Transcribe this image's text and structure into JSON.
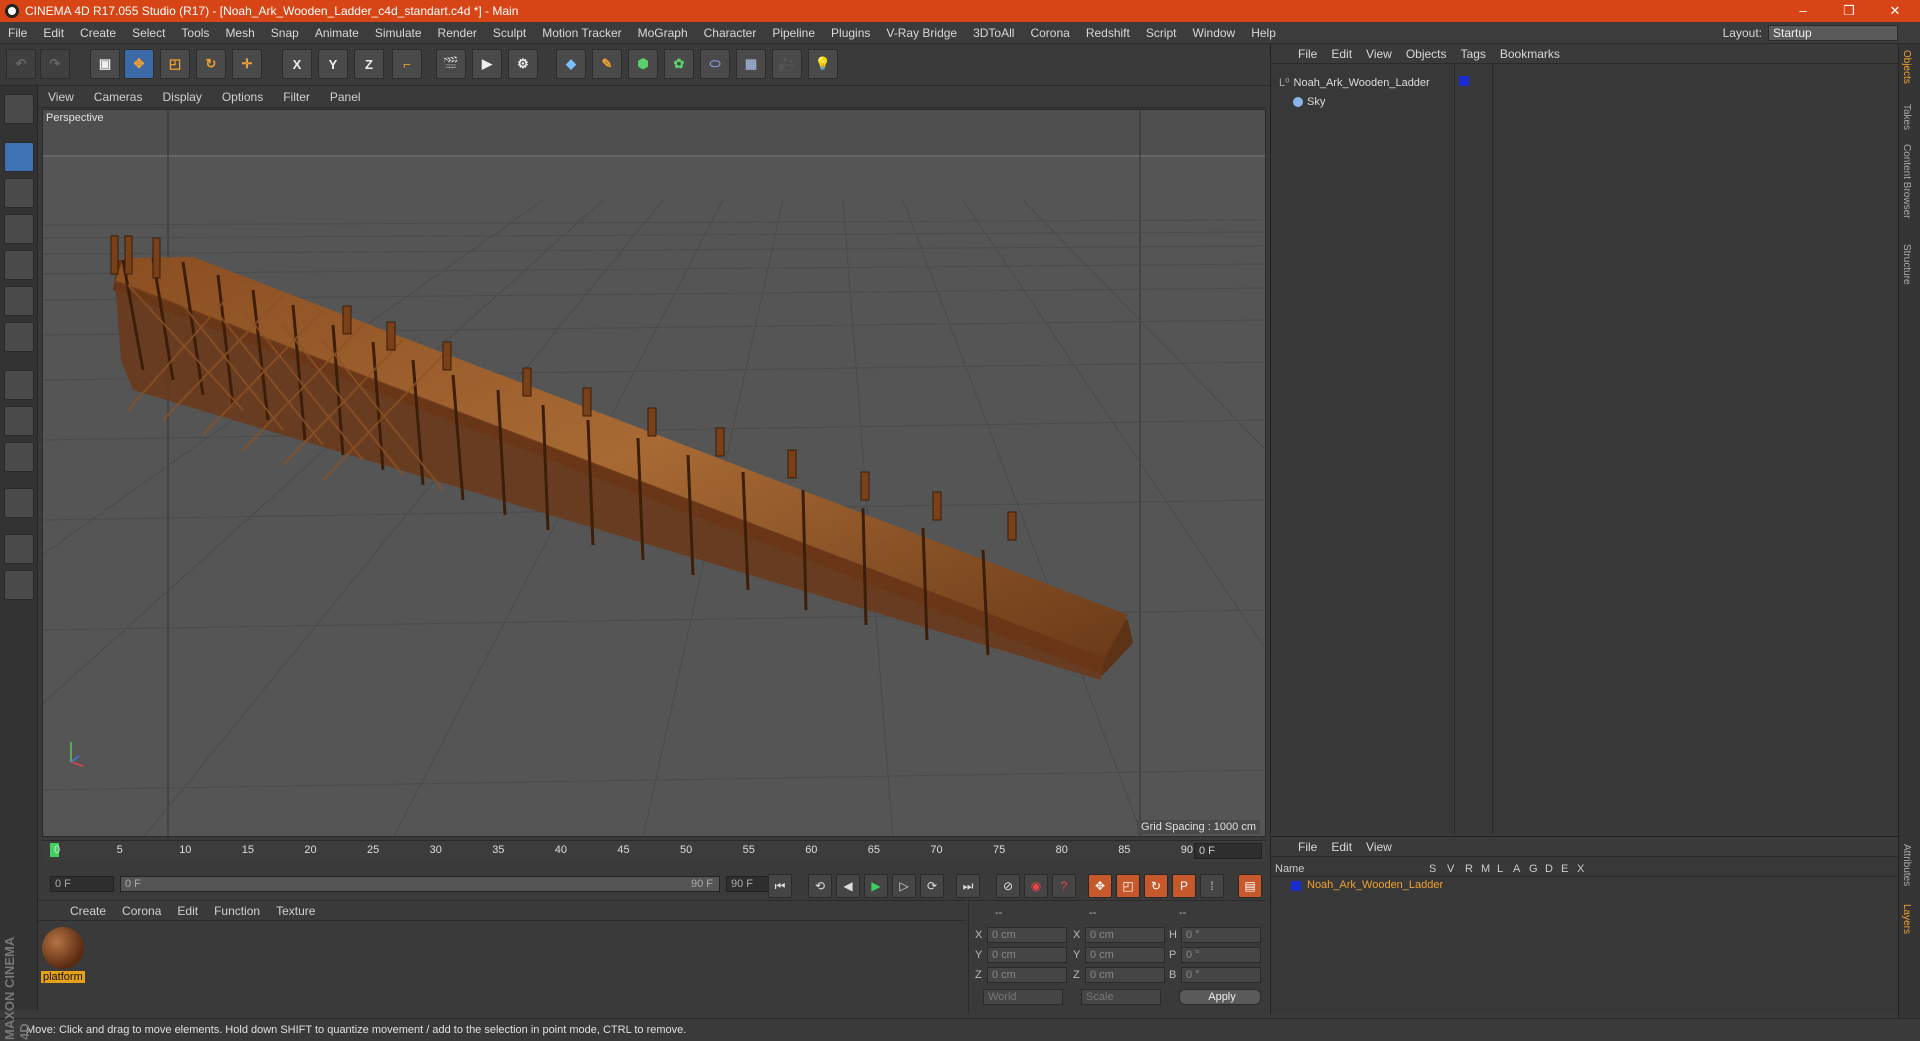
{
  "window": {
    "title": "CINEMA 4D R17.055 Studio (R17) - [Noah_Ark_Wooden_Ladder_c4d_standart.c4d *] - Main",
    "minimize": "–",
    "restore": "❐",
    "close": "✕"
  },
  "menubar": [
    "File",
    "Edit",
    "Create",
    "Select",
    "Tools",
    "Mesh",
    "Snap",
    "Animate",
    "Simulate",
    "Render",
    "Sculpt",
    "Motion Tracker",
    "MoGraph",
    "Character",
    "Pipeline",
    "Plugins",
    "V-Ray Bridge",
    "3DToAll",
    "Corona",
    "Redshift",
    "Script",
    "Window",
    "Help"
  ],
  "layout": {
    "label": "Layout:",
    "value": "Startup"
  },
  "toolbar": {
    "x": "X",
    "y": "Y",
    "z": "Z"
  },
  "viewport": {
    "menu": [
      "View",
      "Cameras",
      "Display",
      "Options",
      "Filter",
      "Panel"
    ],
    "label": "Perspective",
    "grid_spacing": "Grid Spacing : 1000 cm"
  },
  "timeline": {
    "ticks": [
      "0",
      "5",
      "10",
      "15",
      "20",
      "25",
      "30",
      "35",
      "40",
      "45",
      "50",
      "55",
      "60",
      "65",
      "70",
      "75",
      "80",
      "85",
      "90"
    ],
    "current_frame": "0 F"
  },
  "transport": {
    "start": "0 F",
    "range_start": "0 F",
    "range_end": "90 F",
    "end": "90 F"
  },
  "materials": {
    "menu": [
      "Create",
      "Corona",
      "Edit",
      "Function",
      "Texture"
    ],
    "items": [
      {
        "name": "platform"
      }
    ]
  },
  "coordinates": {
    "header": [
      "--",
      "--",
      "--"
    ],
    "rows": [
      {
        "a": "X",
        "av": "0 cm",
        "b": "X",
        "bv": "0 cm",
        "c": "H",
        "cv": "0 °"
      },
      {
        "a": "Y",
        "av": "0 cm",
        "b": "Y",
        "bv": "0 cm",
        "c": "P",
        "cv": "0 °"
      },
      {
        "a": "Z",
        "av": "0 cm",
        "b": "Z",
        "bv": "0 cm",
        "c": "B",
        "cv": "0 °"
      }
    ],
    "mode": "World",
    "scale": "Scale",
    "apply": "Apply"
  },
  "objects": {
    "menu": [
      "File",
      "Edit",
      "View",
      "Objects",
      "Tags",
      "Bookmarks"
    ],
    "items": [
      {
        "name": "Noah_Ark_Wooden_Ladder"
      },
      {
        "name": "Sky"
      }
    ]
  },
  "layers": {
    "menu": [
      "File",
      "Edit",
      "View"
    ],
    "columns": [
      "Name",
      "S",
      "V",
      "R",
      "M",
      "L",
      "A",
      "G",
      "D",
      "E",
      "X"
    ],
    "items": [
      {
        "name": "Noah_Ark_Wooden_Ladder"
      }
    ]
  },
  "sidetabs": [
    "Objects",
    "Takes",
    "Content Browser",
    "Structure",
    "Attributes",
    "Layers"
  ],
  "status": "Move: Click and drag to move elements. Hold down SHIFT to quantize movement / add to the selection in point mode, CTRL to remove.",
  "brand": "MAXON CINEMA 4D"
}
